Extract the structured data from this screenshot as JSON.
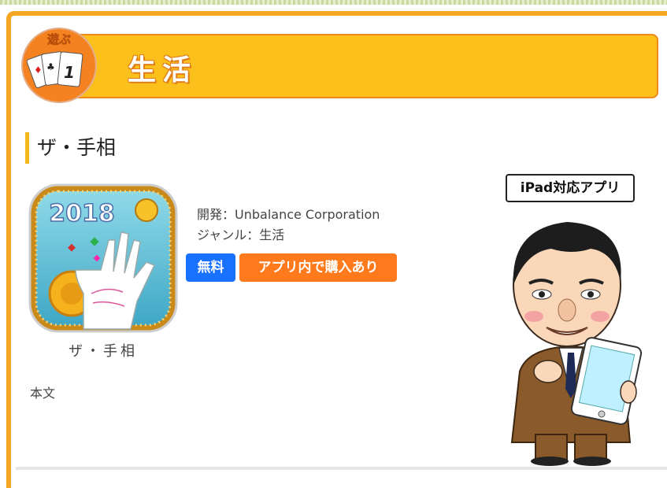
{
  "category": {
    "title": "生活",
    "badge_text": "遊ぶ",
    "badge_card_number": "1"
  },
  "app": {
    "heading": "ザ・手相",
    "name": "ザ・手相",
    "icon_year": "2018",
    "developer": "開発：Unbalance Corporation",
    "genre": "ジャンル：生活",
    "price_label": "無料",
    "iap_label": "アプリ内で購入あり"
  },
  "body_text": "本文",
  "ipad_label": "iPad対応アプリ",
  "colors": {
    "frame": "#f5a623",
    "banner": "#fbc01b",
    "free_badge": "#1971ff",
    "iap_badge": "#ff7a1c"
  },
  "icons": [
    "playing-cards-icon",
    "palm-reading-app-icon",
    "ipad-mascot-character"
  ]
}
